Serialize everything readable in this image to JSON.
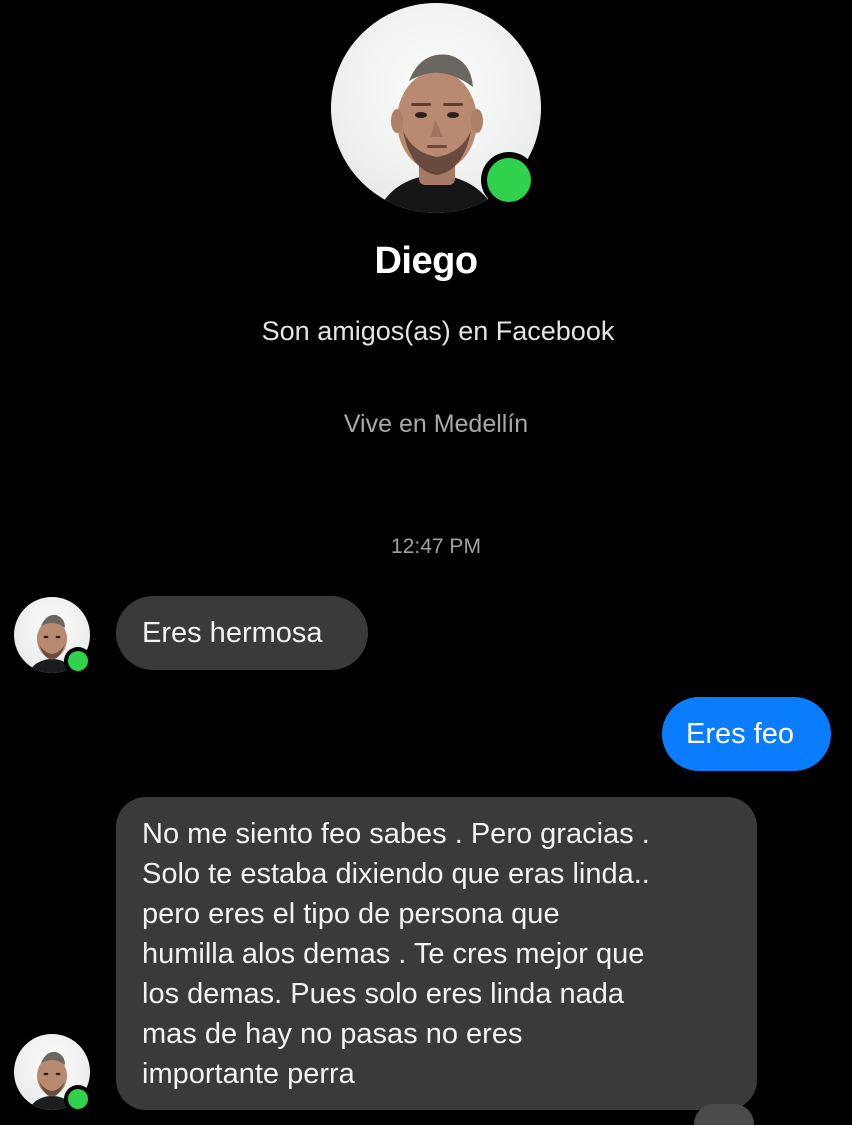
{
  "contact": {
    "name": "Diego",
    "friend_status": "Son amigos(as) en Facebook",
    "location": "Vive en Medellín",
    "online": true
  },
  "conversation": {
    "timestamp": "12:47 PM",
    "messages": [
      {
        "sender": "contact",
        "text": "Eres hermosa"
      },
      {
        "sender": "me",
        "text": "Eres feo"
      },
      {
        "sender": "contact",
        "text": "No me siento feo sabes . Pero gracias .\nSolo te estaba dixiendo que eras linda..\npero eres el tipo de persona que\nhumilla alos demas . Te cres mejor que\nlos demas. Pues solo eres linda nada\nmas de hay no pasas no eres\nimportante perra"
      }
    ]
  },
  "colors": {
    "background": "#000000",
    "received_bubble": "#3a3a3c",
    "sent_bubble": "#0a7cff",
    "online_indicator": "#2fd24a"
  },
  "icons": {
    "profile": "avatar-photo",
    "presence": "online-dot-icon"
  }
}
